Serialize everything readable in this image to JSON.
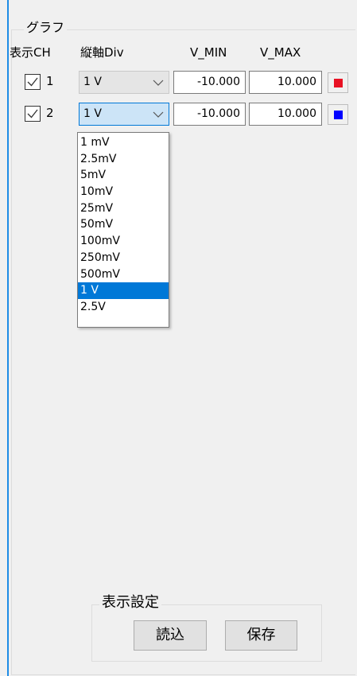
{
  "graph": {
    "title": "グラフ",
    "headers": {
      "display_ch": "表示CH",
      "vertical_div": "縦軸Div",
      "v_min": "V_MIN",
      "v_max": "V_MAX"
    },
    "channels": [
      {
        "number": "1",
        "checked": true,
        "div": "1 V",
        "v_min": "-10.000",
        "v_max": "10.000",
        "color": "#e81123"
      },
      {
        "number": "2",
        "checked": true,
        "div": "1 V",
        "v_min": "-10.000",
        "v_max": "10.000",
        "color": "#0000ff"
      }
    ]
  },
  "dropdown": {
    "open_for_channel": "2",
    "selected": "1 V",
    "options": [
      "1 mV",
      "2.5mV",
      "5mV",
      "10mV",
      "25mV",
      "50mV",
      "100mV",
      "250mV",
      "500mV",
      "1 V",
      "2.5V"
    ]
  },
  "display_settings": {
    "title": "表示設定",
    "load_label": "読込",
    "save_label": "保存"
  },
  "colors": {
    "accent": "#0078d7",
    "window_border": "#1e8ce6",
    "background": "#f0f0f0"
  }
}
